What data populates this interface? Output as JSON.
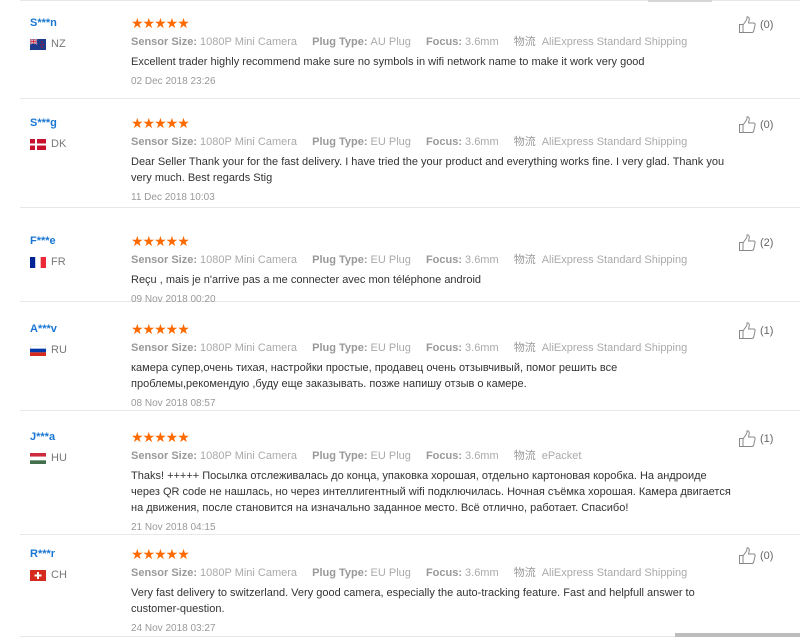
{
  "labels": {
    "sensor": "Sensor Size:",
    "plug": "Plug Type:",
    "focus": "Focus:",
    "shipping": "物流"
  },
  "stars": "★★★★★",
  "colors": {
    "stars": "#ff6a00",
    "username": "#1976d2"
  },
  "reviews": [
    {
      "user": "S***n",
      "country": "NZ",
      "flag": "nz-flag",
      "sensor": "1080P Mini Camera",
      "plug": "AU Plug",
      "focus": "3.6mm",
      "shipping": "AliExpress Standard Shipping",
      "text": "Excellent trader highly recommend make sure no symbols in wifi network name to make it work very good",
      "date": "02 Dec 2018 23:26",
      "helpful": "(0)"
    },
    {
      "user": "S***g",
      "country": "DK",
      "flag": "dk-flag",
      "sensor": "1080P Mini Camera",
      "plug": "EU Plug",
      "focus": "3.6mm",
      "shipping": "AliExpress Standard Shipping",
      "text": "Dear Seller Thank your for the fast delivery. I have tried the your product and everything works fine. I very glad. Thank you very much. Best regards Stig",
      "date": "11 Dec 2018 10:03",
      "helpful": "(0)"
    },
    {
      "user": "F***e",
      "country": "FR",
      "flag": "fr-flag",
      "sensor": "1080P Mini Camera",
      "plug": "EU Plug",
      "focus": "3.6mm",
      "shipping": "AliExpress Standard Shipping",
      "text": "Reçu , mais je n'arrive pas a me connecter avec mon téléphone android",
      "date": "09 Nov 2018 00:20",
      "helpful": "(2)"
    },
    {
      "user": "A***v",
      "country": "RU",
      "flag": "ru-flag",
      "sensor": "1080P Mini Camera",
      "plug": "EU Plug",
      "focus": "3.6mm",
      "shipping": "AliExpress Standard Shipping",
      "text": "камера супер,очень тихая, настройки простые, продавец очень отзывчивый, помог решить все проблемы,рекомендую ,буду еще заказывать. позже напишу отзыв о камере.",
      "date": "08 Nov 2018 08:57",
      "helpful": "(1)"
    },
    {
      "user": "J***a",
      "country": "HU",
      "flag": "hu-flag",
      "sensor": "1080P Mini Camera",
      "plug": "EU Plug",
      "focus": "3.6mm",
      "shipping": "ePacket",
      "text": "Thaks! +++++ Посылка отслеживалась до конца, упаковка хорошая, отдельно картоновая коробка. На андроиде через QR code не нашлась, но через интеллигентный wifi подключилась. Ночная съёмка хорошая. Камера двигается на движения, после становится на изначально заданное место. Всё отлично, работает. Спасибо!",
      "date": "21 Nov 2018 04:15",
      "helpful": "(1)"
    },
    {
      "user": "R***r",
      "country": "CH",
      "flag": "ch-flag",
      "sensor": "1080P Mini Camera",
      "plug": "EU Plug",
      "focus": "3.6mm",
      "shipping": "AliExpress Standard Shipping",
      "text": "Very fast delivery to switzerland. Very good camera, especially the auto-tracking feature. Fast and helpfull answer to customer-question.",
      "date": "24 Nov 2018 03:27",
      "helpful": "(0)"
    }
  ]
}
